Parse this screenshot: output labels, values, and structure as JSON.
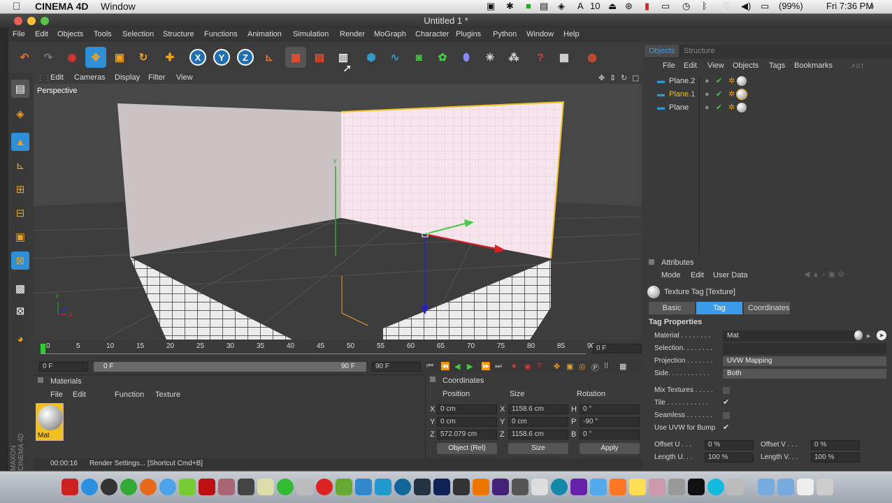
{
  "mac_menubar": {
    "app_name": "CINEMA 4D",
    "menu": "Window",
    "battery": "(99%)",
    "clock": "Fri 7:36 PM",
    "ai_badge": "10"
  },
  "window": {
    "title": "Untitled 1 *"
  },
  "menu": [
    "File",
    "Edit",
    "Objects",
    "Tools",
    "Selection",
    "Structure",
    "Functions",
    "Animation",
    "Simulation",
    "Render",
    "MoGraph",
    "Character",
    "Plugins",
    "Python",
    "Window",
    "Help"
  ],
  "toolbar": {
    "axis_x": "X",
    "axis_y": "Y",
    "axis_z": "Z"
  },
  "viewport": {
    "menu": [
      "Edit",
      "Cameras",
      "Display",
      "Filter",
      "View"
    ],
    "label": "Perspective",
    "axis_y": "Y",
    "axis_z": "Z",
    "axis_x": "X"
  },
  "timeline": {
    "ticks": [
      "0",
      "5",
      "10",
      "15",
      "20",
      "25",
      "30",
      "35",
      "40",
      "45",
      "50",
      "55",
      "60",
      "65",
      "70",
      "75",
      "80",
      "85",
      "90"
    ],
    "current_frame": "0 F",
    "start_field": "0 F",
    "range_start": "0 F",
    "range_end": "90 F",
    "end_field": "90 F"
  },
  "materials": {
    "title": "Materials",
    "menu": [
      "File",
      "Edit",
      "Function",
      "Texture"
    ],
    "items": [
      {
        "name": "Mat"
      }
    ]
  },
  "coordinates": {
    "title": "Coordinates",
    "headers": [
      "Position",
      "Size",
      "Rotation"
    ],
    "rows": [
      {
        "axis": "X",
        "pos": "0 cm",
        "saxis": "X",
        "size": "1158.6 cm",
        "raxis": "H",
        "rot": "0 °"
      },
      {
        "axis": "Y",
        "pos": "0 cm",
        "saxis": "Y",
        "size": "0 cm",
        "raxis": "P",
        "rot": "-90 °"
      },
      {
        "axis": "Z",
        "pos": "572.079 cm",
        "saxis": "Z",
        "size": "1158.6 cm",
        "raxis": "B",
        "rot": "0 °"
      }
    ],
    "mode": "Object (Rel)",
    "size_mode": "Size",
    "apply": "Apply"
  },
  "status": {
    "time": "00:00:16",
    "message": "Render Settings... [Shortcut Cmd+B]"
  },
  "objects_panel": {
    "tabs": [
      "Objects",
      "Structure"
    ],
    "menu": [
      "File",
      "Edit",
      "View",
      "Objects",
      "Tags",
      "Bookmarks"
    ],
    "items": [
      {
        "name": "Plane.2",
        "selected": false
      },
      {
        "name": "Plane.1",
        "selected": true
      },
      {
        "name": "Plane",
        "selected": false
      }
    ]
  },
  "attributes": {
    "title": "Attributes",
    "menu": [
      "Mode",
      "Edit",
      "User Data"
    ],
    "object": "Texture Tag [Texture]",
    "tabs": [
      "Basic",
      "Tag",
      "Coordinates"
    ],
    "section": "Tag Properties",
    "material_label": "Material . . . . . . . .",
    "material_value": "Mat",
    "selection_label": "Selection. . . . . . . .",
    "projection_label": "Projection . . . . . . .",
    "projection_value": "UVW Mapping",
    "side_label": "Side. . . . . . . . . . .",
    "side_value": "Both",
    "mix_label": "Mix Textures . . . . .",
    "tile_label": "Tile . . . . . . . . . . .",
    "seamless_label": "Seamless . . . . . . .",
    "uvw_label": "Use UVW for Bump",
    "offset_u_label": "Offset U . . .",
    "offset_u": "0 %",
    "offset_v_label": "Offset V . . .",
    "offset_v": "0 %",
    "length_u_label": "Length U. . .",
    "length_u": "100 %",
    "length_v_label": "Length V. . .",
    "length_v": "100 %"
  },
  "colors": {
    "accent": "#2e8fd6",
    "highlight": "#f0c020",
    "tab_active": "#3c9be8"
  }
}
